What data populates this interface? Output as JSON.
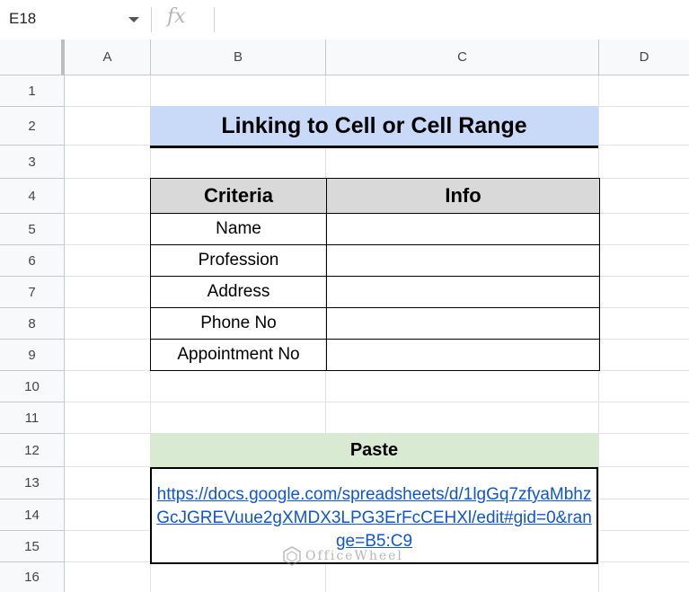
{
  "formula_bar": {
    "name_box": "E18",
    "fx_label": "fx",
    "formula": ""
  },
  "columns": [
    "A",
    "B",
    "C",
    "D"
  ],
  "rows": [
    "1",
    "2",
    "3",
    "4",
    "5",
    "6",
    "7",
    "8",
    "9",
    "10",
    "11",
    "12",
    "13",
    "14",
    "15",
    "16"
  ],
  "sheet": {
    "title": "Linking to Cell or Cell Range",
    "table": {
      "headers": [
        "Criteria",
        "Info"
      ],
      "rows": [
        {
          "criteria": "Name",
          "info": ""
        },
        {
          "criteria": "Profession",
          "info": ""
        },
        {
          "criteria": "Address",
          "info": ""
        },
        {
          "criteria": "Phone No",
          "info": ""
        },
        {
          "criteria": "Appointment No",
          "info": ""
        }
      ]
    },
    "paste": {
      "header": "Paste",
      "link": "https://docs.google.com/spreadsheets/d/1lgGq7zfyaMbhzGcJGREVuue2gXMDX3LPG3ErFcCEHXl/edit#gid=0&range=B5:C9"
    }
  },
  "watermark": {
    "text": "OfficeWheel"
  },
  "colors": {
    "title_bg": "#c9daf8",
    "header_bg": "#d9d9d9",
    "paste_bg": "#d9ead3",
    "link": "#1155cc"
  }
}
